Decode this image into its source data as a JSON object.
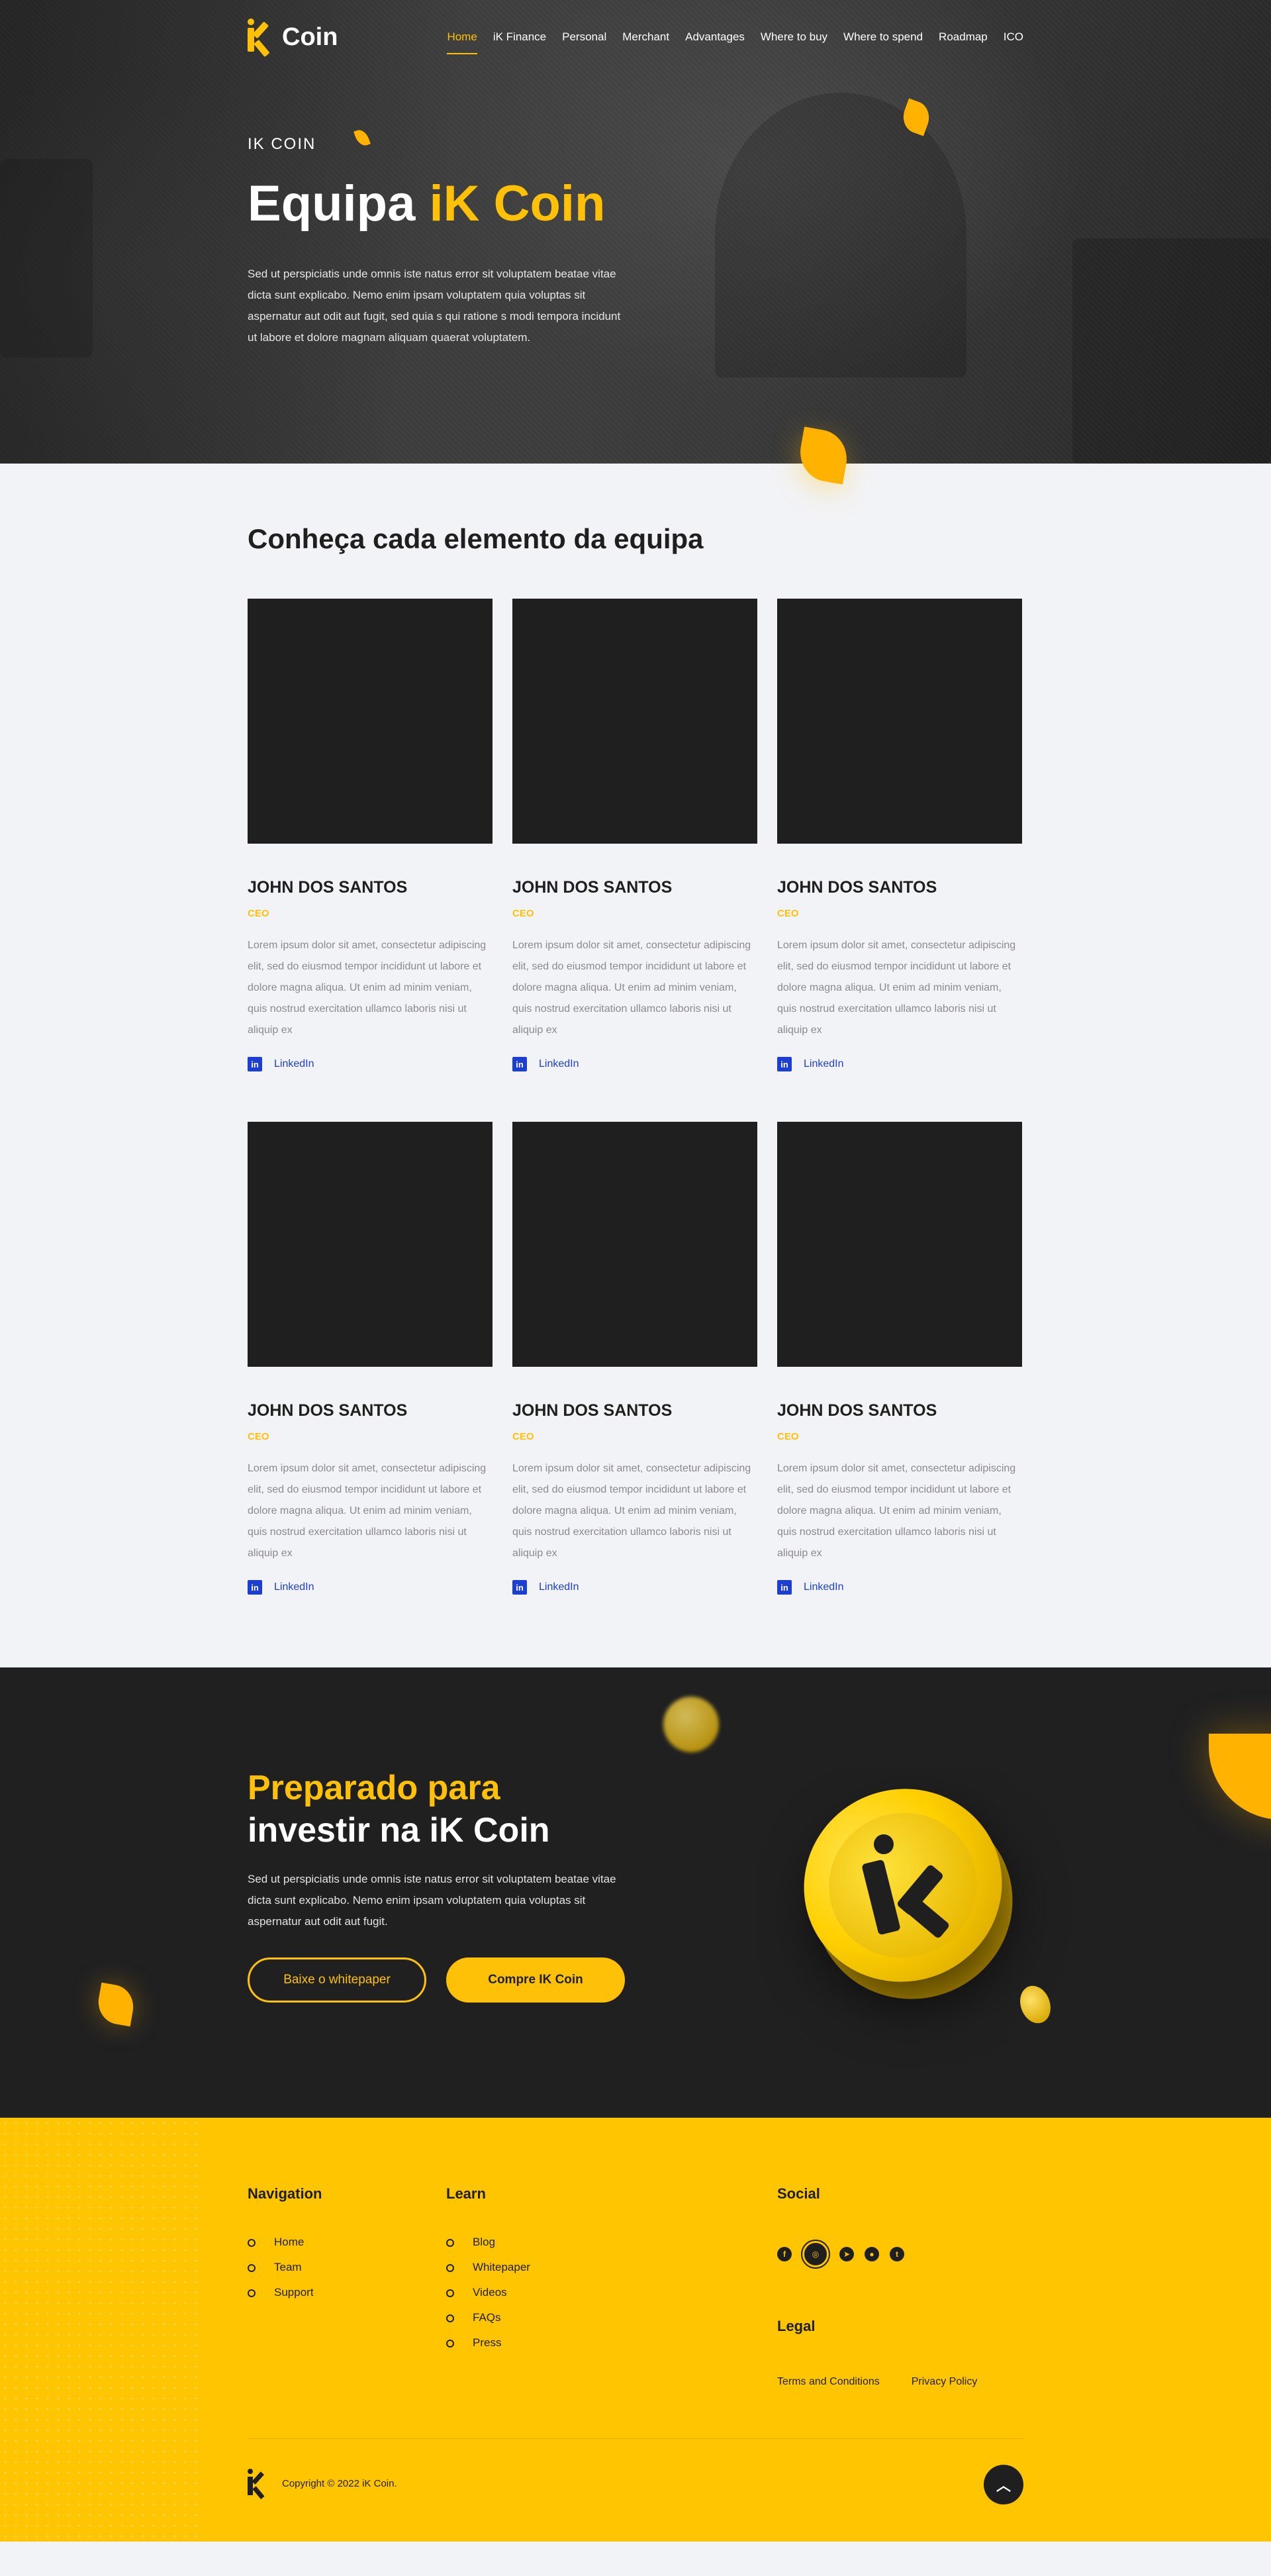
{
  "brand": {
    "name": "Coin",
    "accent": "#ffc107",
    "dark": "#1f1f20"
  },
  "nav": {
    "items": [
      {
        "label": "Home",
        "active": true
      },
      {
        "label": "iK Finance"
      },
      {
        "label": "Personal"
      },
      {
        "label": "Merchant"
      },
      {
        "label": "Advantages"
      },
      {
        "label": "Where to buy"
      },
      {
        "label": "Where to spend"
      },
      {
        "label": "Roadmap"
      },
      {
        "label": "ICO"
      }
    ]
  },
  "hero": {
    "eyebrow": "IK COIN",
    "title_main": "Equipa",
    "title_accent": "iK Coin",
    "text": "Sed ut perspiciatis unde omnis iste natus error sit voluptatem beatae vitae dicta sunt explicabo. Nemo enim ipsam voluptatem quia voluptas sit aspernatur aut odit aut fugit, sed quia s qui ratione s modi tempora incidunt ut labore et dolore magnam aliquam quaerat voluptatem."
  },
  "team": {
    "title": "Conheça cada elemento da equipa",
    "members": [
      {
        "name": "JOHN DOS SANTOS",
        "role": "CEO",
        "bio": "Lorem ipsum dolor sit amet, consectetur adipiscing elit, sed do eiusmod tempor incididunt ut labore et dolore magna aliqua. Ut enim ad minim veniam, quis nostrud exercitation ullamco laboris nisi ut aliquip ex",
        "link": "LinkedIn"
      },
      {
        "name": "JOHN DOS SANTOS",
        "role": "CEO",
        "bio": "Lorem ipsum dolor sit amet, consectetur adipiscing elit, sed do eiusmod tempor incididunt ut labore et dolore magna aliqua. Ut enim ad minim veniam, quis nostrud exercitation ullamco laboris nisi ut aliquip ex",
        "link": "LinkedIn"
      },
      {
        "name": "JOHN DOS SANTOS",
        "role": "CEO",
        "bio": "Lorem ipsum dolor sit amet, consectetur adipiscing elit, sed do eiusmod tempor incididunt ut labore et dolore magna aliqua. Ut enim ad minim veniam, quis nostrud exercitation ullamco laboris nisi ut aliquip ex",
        "link": "LinkedIn"
      },
      {
        "name": "JOHN DOS SANTOS",
        "role": "CEO",
        "bio": "Lorem ipsum dolor sit amet, consectetur adipiscing elit, sed do eiusmod tempor incididunt ut labore et dolore magna aliqua. Ut enim ad minim veniam, quis nostrud exercitation ullamco laboris nisi ut aliquip ex",
        "link": "LinkedIn"
      },
      {
        "name": "JOHN DOS SANTOS",
        "role": "CEO",
        "bio": "Lorem ipsum dolor sit amet, consectetur adipiscing elit, sed do eiusmod tempor incididunt ut labore et dolore magna aliqua. Ut enim ad minim veniam, quis nostrud exercitation ullamco laboris nisi ut aliquip ex",
        "link": "LinkedIn"
      },
      {
        "name": "JOHN DOS SANTOS",
        "role": "CEO",
        "bio": "Lorem ipsum dolor sit amet, consectetur adipiscing elit, sed do eiusmod tempor incididunt ut labore et dolore magna aliqua. Ut enim ad minim veniam, quis nostrud exercitation ullamco laboris nisi ut aliquip ex",
        "link": "LinkedIn"
      }
    ]
  },
  "cta": {
    "title_line1": "Preparado para",
    "title_line2": "investir na iK Coin",
    "text": "Sed ut perspiciatis unde omnis iste natus error sit voluptatem beatae vitae dicta sunt explicabo. Nemo enim ipsam voluptatem quia voluptas sit aspernatur aut odit aut fugit.",
    "btn_whitepaper": "Baixe o whitepaper",
    "btn_buy": "Compre IK Coin"
  },
  "footer": {
    "navigation": {
      "title": "Navigation",
      "items": [
        "Home",
        "Team",
        "Support"
      ]
    },
    "learn": {
      "title": "Learn",
      "items": [
        "Blog",
        "Whitepaper",
        "Videos",
        "FAQs",
        "Press"
      ]
    },
    "social": {
      "title": "Social",
      "icons": [
        "facebook-icon",
        "instagram-icon",
        "telegram-icon",
        "reddit-icon",
        "twitter-icon"
      ]
    },
    "legal": {
      "title": "Legal",
      "terms": "Terms and Conditions",
      "privacy": "Privacy Policy"
    },
    "copyright": "Copyright © 2022 iK Coin."
  }
}
